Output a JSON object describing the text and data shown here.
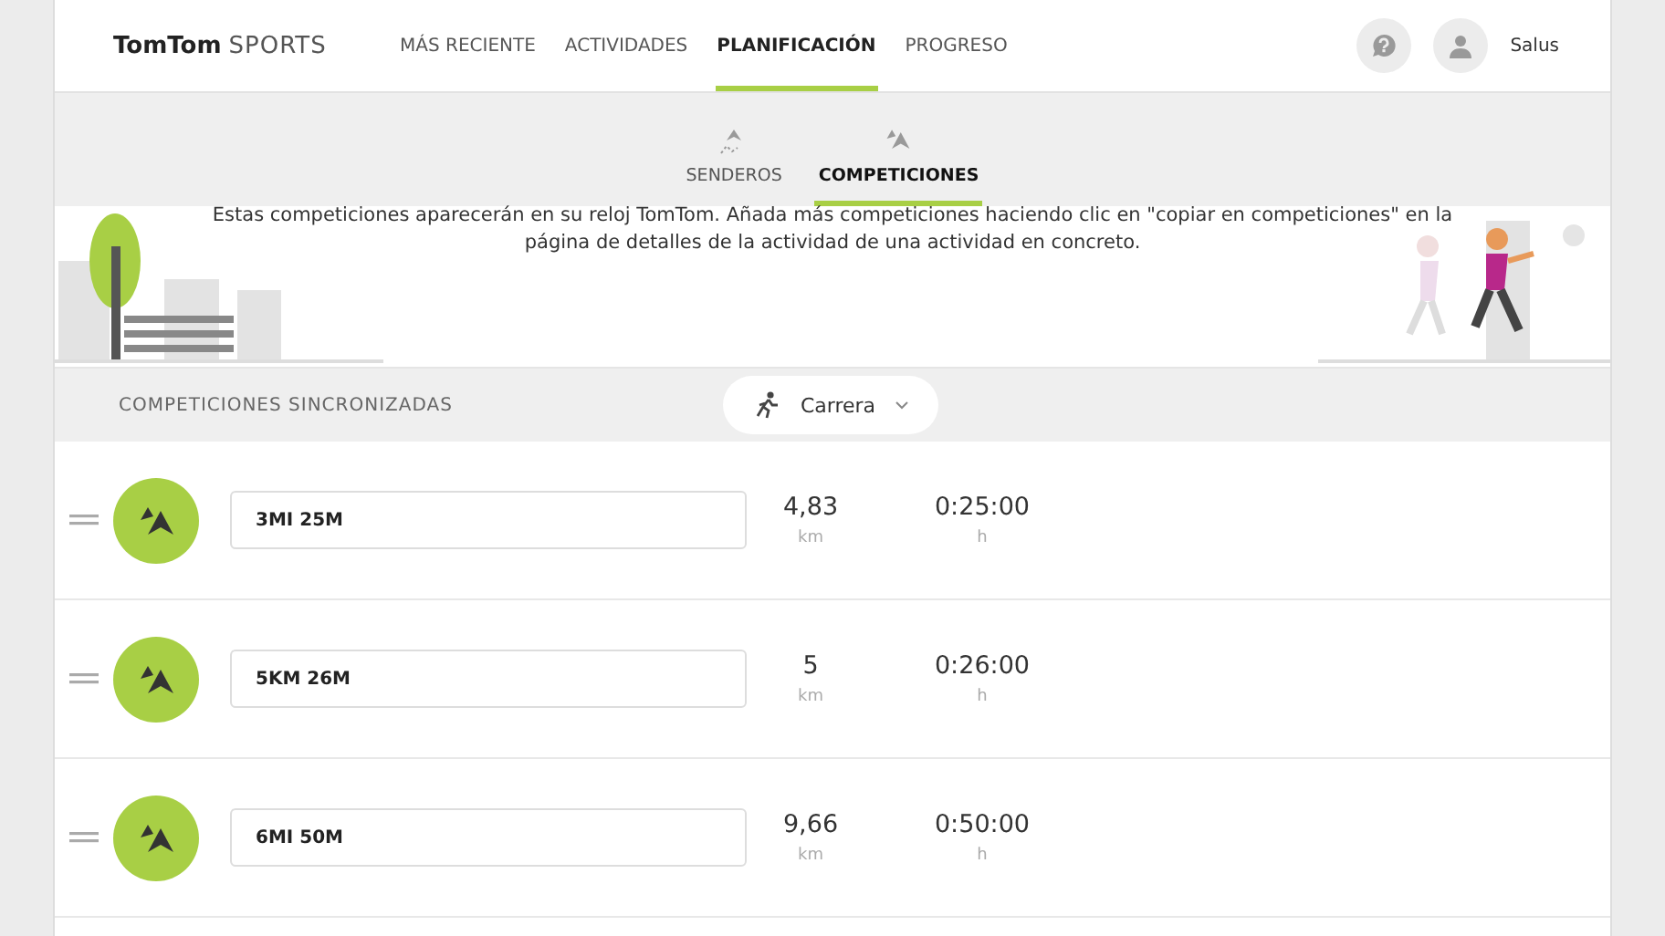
{
  "header": {
    "logo": {
      "brand": "TomTom",
      "product": "SPORTS"
    },
    "nav": [
      {
        "label": "MÁS RECIENTE",
        "selected": false
      },
      {
        "label": "ACTIVIDADES",
        "selected": false
      },
      {
        "label": "PLANIFICACIÓN",
        "selected": true
      },
      {
        "label": "PROGRESO",
        "selected": false
      }
    ],
    "user": "Salus"
  },
  "subnav": [
    {
      "label": "SENDEROS",
      "selected": false,
      "kind": "trail"
    },
    {
      "label": "COMPETICIONES",
      "selected": true,
      "kind": "race"
    }
  ],
  "intro": "Estas competiciones aparecerán en su reloj TomTom. Añada más competiciones haciendo clic en \"copiar en competiciones\" en la página de detalles de la actividad de una actividad en concreto.",
  "section": {
    "title": "COMPETICIONES SINCRONIZADAS",
    "sport": "Carrera"
  },
  "races": [
    {
      "name": "3MI 25M",
      "distance": "4,83",
      "distance_unit": "km",
      "time": "0:25:00",
      "time_unit": "h"
    },
    {
      "name": "5KM 26M",
      "distance": "5",
      "distance_unit": "km",
      "time": "0:26:00",
      "time_unit": "h"
    },
    {
      "name": "6MI 50M",
      "distance": "9,66",
      "distance_unit": "km",
      "time": "0:50:00",
      "time_unit": "h"
    }
  ]
}
